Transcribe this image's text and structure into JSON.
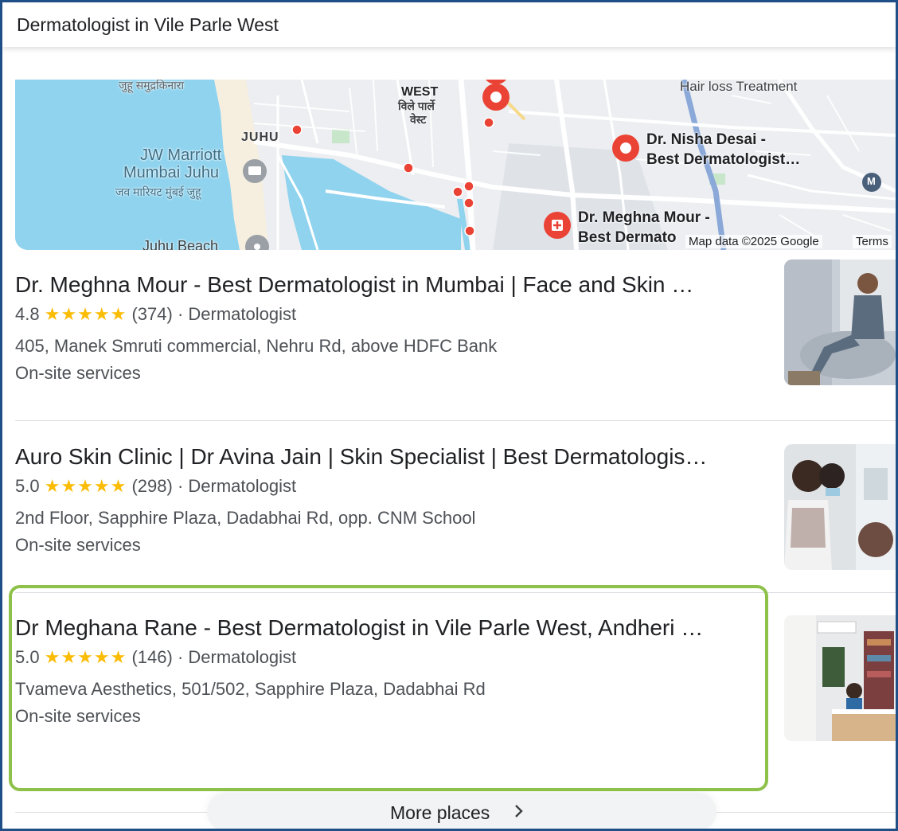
{
  "search": {
    "query": "Dermatologist in Vile Parle West"
  },
  "map": {
    "labels": {
      "juhu_hindi_top": "जुहू समुद्रकिनारा",
      "vile_parle_en": "WEST",
      "vile_parle_hi": "विले पार्ले",
      "vile_parle_hi2": "वेस्ट",
      "juhu": "JUHU",
      "jw_marriott_1": "JW Marriott",
      "jw_marriott_2": "Mumbai Juhu",
      "jw_marriott_hi": "जव मारियट मुंबई जुहू",
      "hair_loss": "Hair loss Treatment",
      "nisha_1": "Dr. Nisha Desai -",
      "nisha_2": "Best Dermatologist…",
      "meghna_1": "Dr. Meghna Mour -",
      "meghna_2": "Best Dermato",
      "juhu_beach": "Juhu Beach",
      "map_data": "Map data ©2025 Google",
      "terms": "Terms",
      "metro": "M"
    }
  },
  "results": [
    {
      "title": "Dr. Meghna Mour - Best Dermatologist in Mumbai | Face and Skin …",
      "rating": "4.8",
      "stars": "★★★★★",
      "reviews": "(374)",
      "sep": "·",
      "category": "Dermatologist",
      "address": "405, Manek Smruti commercial, Nehru Rd, above HDFC Bank",
      "services": "On-site services"
    },
    {
      "title": "Auro Skin Clinic | Dr Avina Jain | Skin Specialist | Best Dermatologis…",
      "rating": "5.0",
      "stars": "★★★★★",
      "reviews": "(298)",
      "sep": "·",
      "category": "Dermatologist",
      "address": "2nd Floor, Sapphire Plaza, Dadabhai Rd, opp. CNM School",
      "services": "On-site services"
    },
    {
      "title": "Dr Meghana Rane - Best Dermatologist in Vile Parle West, Andheri …",
      "rating": "5.0",
      "stars": "★★★★★",
      "reviews": "(146)",
      "sep": "·",
      "category": "Dermatologist",
      "address": "Tvameva Aesthetics, 501/502, Sapphire Plaza, Dadabhai Rd",
      "services": "On-site services"
    }
  ],
  "more_places": {
    "label": "More places",
    "icon": "chevron-right-icon"
  },
  "colors": {
    "star": "#fbbc04",
    "pin": "#ea4335",
    "highlight": "#8dc14a",
    "water": "#8fd3ee"
  }
}
